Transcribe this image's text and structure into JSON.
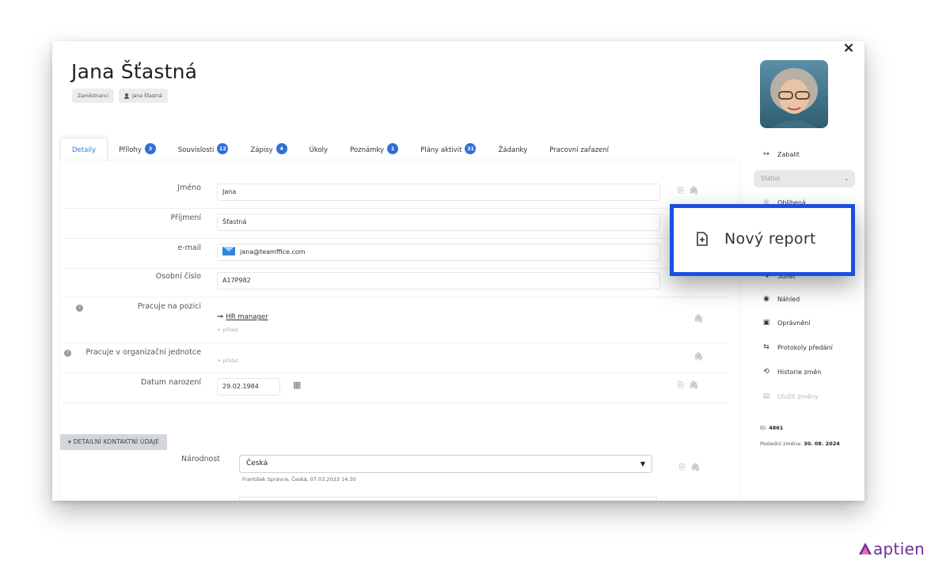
{
  "window": {
    "title": "Jana Šťastná",
    "chips": [
      "Zaměstnanci",
      "Jana Šťastná"
    ],
    "close_label": "×"
  },
  "tabs": [
    {
      "label": "Detaily",
      "badge": null,
      "active": true
    },
    {
      "label": "Přílohy",
      "badge": "3"
    },
    {
      "label": "Souvislosti",
      "badge": "12"
    },
    {
      "label": "Zápisy",
      "badge": "4"
    },
    {
      "label": "Úkoly",
      "badge": null
    },
    {
      "label": "Poznámky",
      "badge": "1"
    },
    {
      "label": "Plány aktivit",
      "badge": "31"
    },
    {
      "label": "Žádanky",
      "badge": null
    },
    {
      "label": "Pracovní zařazení",
      "badge": null
    }
  ],
  "form": {
    "jmeno": {
      "label": "Jméno",
      "value": "Jana"
    },
    "prijmeni": {
      "label": "Příjmení",
      "value": "Šťastná"
    },
    "email": {
      "label": "e-mail",
      "value": "jana@teamffice.com"
    },
    "osobni_cislo": {
      "label": "Osobní číslo",
      "value": "A17P982"
    },
    "pozice": {
      "label": "Pracuje na pozici",
      "value": "HR manager",
      "add": "+ přidat"
    },
    "org_jednotka": {
      "label": "Pracuje v organizační jednotce",
      "add": "+ přidat"
    },
    "datum_narozeni": {
      "label": "Datum narození",
      "value": "29.02.1984"
    }
  },
  "section": {
    "title": "DETAILNÍ KONTAKTNÍ ÚDAJE",
    "narodnost": {
      "label": "Národnost",
      "value": "Česká",
      "sub": "František Správce, Česká, 07.03.2023 14:30"
    }
  },
  "sidebar": {
    "zabalit": "Zabalit",
    "status_placeholder": "Status",
    "items": [
      {
        "label": "Oblíbená",
        "icon": "star-icon"
      },
      {
        "label": "Náhled",
        "icon": "eye-icon"
      },
      {
        "label": "Oprávnění",
        "icon": "id-card-icon"
      },
      {
        "label": "Protokoly předání",
        "icon": "protocol-icon"
      },
      {
        "label": "Historie změn",
        "icon": "history-icon"
      },
      {
        "label": "Uložit změny",
        "icon": "save-icon",
        "disabled": true
      }
    ],
    "partial_item": "Sdílet",
    "id_label": "ID:",
    "id_value": "4861",
    "last_change_label": "Poslední změna:",
    "last_change_value": "30. 08. 2024"
  },
  "popup": {
    "label": "Nový report",
    "accent": "#1a4fe0"
  },
  "logo": {
    "text": "aptien",
    "color": "#6a2ea0"
  }
}
